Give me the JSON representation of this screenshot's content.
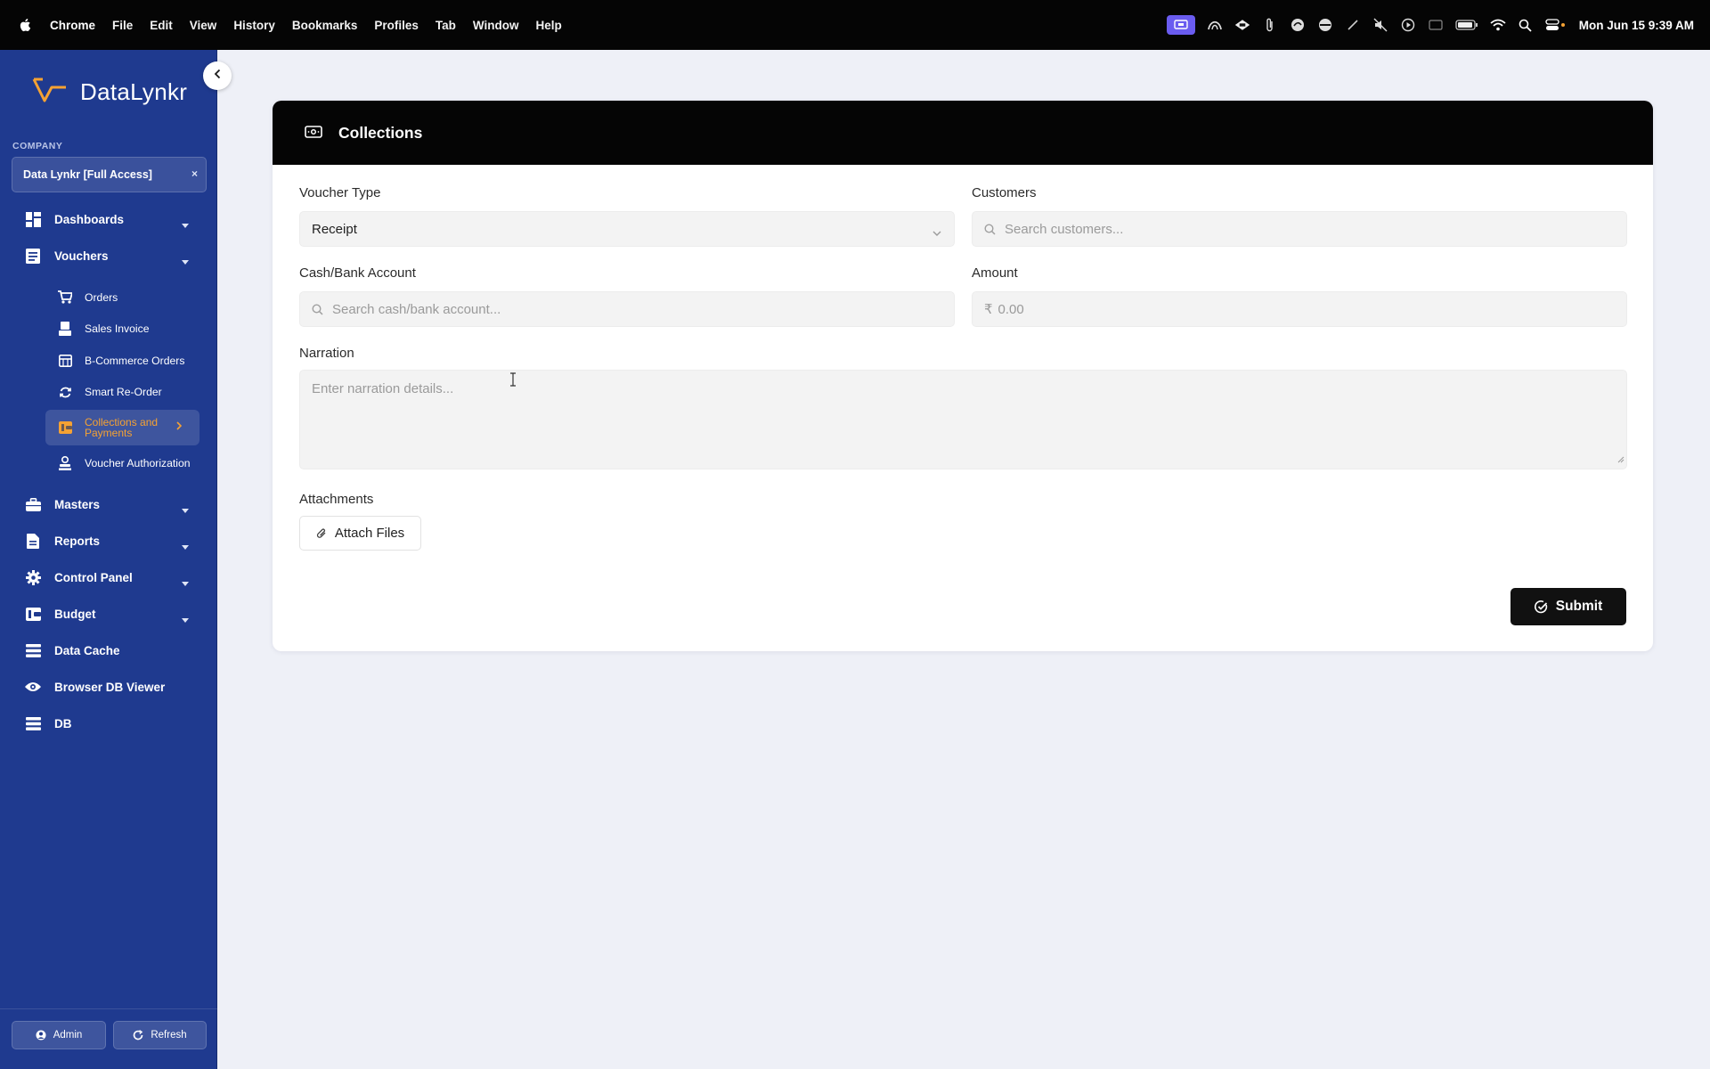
{
  "menubar": {
    "app_name": "Chrome",
    "menus": [
      "File",
      "Edit",
      "View",
      "History",
      "Bookmarks",
      "Profiles",
      "Tab",
      "Window",
      "Help"
    ],
    "clock": "Mon Jun 15  9:39 AM"
  },
  "sidebar": {
    "brand": "DataLynkr",
    "company_label": "COMPANY",
    "company_value": "Data Lynkr [Full Access]",
    "company_clear": "×",
    "items": [
      {
        "label": "Dashboards",
        "icon": "dashboard-icon"
      },
      {
        "label": "Vouchers",
        "icon": "vouchers-icon"
      },
      {
        "label": "Masters",
        "icon": "briefcase-icon"
      },
      {
        "label": "Reports",
        "icon": "report-icon"
      },
      {
        "label": "Control Panel",
        "icon": "gear-icon"
      },
      {
        "label": "Budget",
        "icon": "wallet-icon"
      },
      {
        "label": "Data Cache",
        "icon": "list-icon"
      },
      {
        "label": "Browser DB Viewer",
        "icon": "eye-icon"
      },
      {
        "label": "DB",
        "icon": "list-icon"
      }
    ],
    "sub_items": [
      {
        "label": "Orders",
        "icon": "cart-icon"
      },
      {
        "label": "Sales Invoice",
        "icon": "invoice-icon"
      },
      {
        "label": "B-Commerce Orders",
        "icon": "store-icon"
      },
      {
        "label": "Smart Re-Order",
        "icon": "refresh-icon"
      },
      {
        "label": "Collections and Payments",
        "icon": "wallet-icon"
      },
      {
        "label": "Voucher Authorization",
        "icon": "user-check-icon"
      }
    ],
    "footer": {
      "admin": "Admin",
      "refresh": "Refresh"
    },
    "colors": {
      "background": "#1f3a8f",
      "active_text": "#f5a233"
    }
  },
  "main": {
    "title": "Collections",
    "voucher_type": {
      "label": "Voucher Type",
      "value": "Receipt"
    },
    "customers": {
      "label": "Customers",
      "placeholder": "Search customers..."
    },
    "cash_bank": {
      "label": "Cash/Bank Account",
      "placeholder": "Search cash/bank account..."
    },
    "amount": {
      "label": "Amount",
      "currency": "₹",
      "placeholder": "0.00"
    },
    "narration": {
      "label": "Narration",
      "placeholder": "Enter narration details..."
    },
    "attachments": {
      "label": "Attachments",
      "button": "Attach Files"
    },
    "submit": "Submit"
  }
}
